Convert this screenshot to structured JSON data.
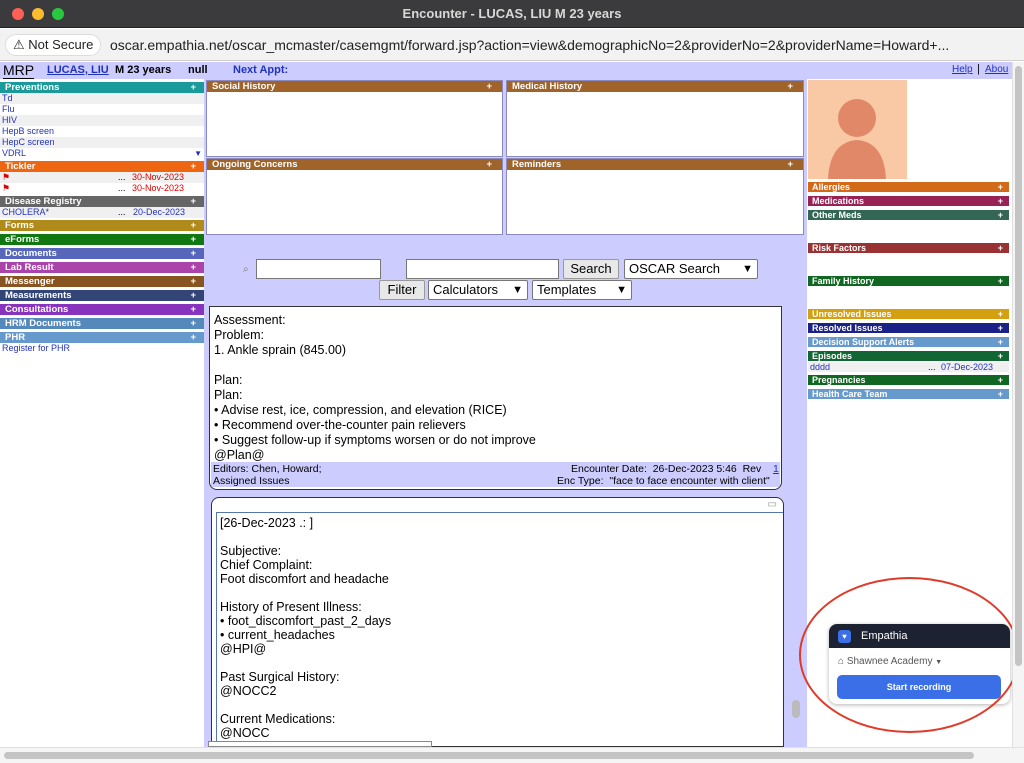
{
  "window": {
    "title": "Encounter - LUCAS, LIU M 23 years"
  },
  "address": {
    "security_label": "Not Secure",
    "url": "oscar.empathia.net/oscar_mcmaster/casemgmt/forward.jsp?action=view&demographicNo=2&providerNo=2&providerName=Howard+..."
  },
  "header": {
    "mrp": "MRP",
    "patient_name": "LUCAS, LIU",
    "patient_info": "M 23 years",
    "null_label": "null",
    "next_appt": "Next Appt:",
    "help": "Help",
    "about": "Abou"
  },
  "left": {
    "preventions": {
      "label": "Preventions",
      "items": [
        "Td",
        "Flu",
        "HIV",
        "HepB screen",
        "HepC screen",
        "VDRL"
      ]
    },
    "tickler": {
      "label": "Tickler",
      "items": [
        {
          "dots": "...",
          "date": "30-Nov-2023"
        },
        {
          "dots": "...",
          "date": "30-Nov-2023"
        }
      ]
    },
    "disease_registry": {
      "label": "Disease Registry",
      "items": [
        {
          "name": "CHOLERA*",
          "dots": "...",
          "date": "20-Dec-2023"
        }
      ]
    },
    "forms": "Forms",
    "eforms": "eForms",
    "documents": "Documents",
    "lab_result": "Lab Result",
    "messenger": "Messenger",
    "measurements": "Measurements",
    "consultations": "Consultations",
    "hrm_documents": "HRM Documents",
    "phr": {
      "label": "PHR",
      "items": [
        "Register for PHR"
      ]
    },
    "plus": "+"
  },
  "center": {
    "social_history": "Social History",
    "medical_history": "Medical History",
    "ongoing_concerns": "Ongoing Concerns",
    "reminders": "Reminders",
    "search_button": "Search",
    "search_select": "OSCAR Search",
    "filter_button": "Filter",
    "calculators": "Calculators",
    "templates": "Templates"
  },
  "note1": {
    "text": "Assessment:\nProblem:\n1. Ankle sprain (845.00)\n\nPlan:\nPlan:\n• Advise rest, ice, compression, and elevation (RICE)\n• Recommend over-the-counter pain relievers\n• Suggest follow-up if symptoms worsen or do not improve\n@Plan@",
    "editors": "Editors: Chen, Howard;",
    "encounter_date": "Encounter Date:  26-Dec-2023 5:46  Rev",
    "rev": "1",
    "assigned_issues": "Assigned Issues",
    "enc_type": "Enc Type:  \"face to face encounter with client\""
  },
  "note2": {
    "text": "[26-Dec-2023 .: ]\n\nSubjective:\nChief Complaint:\nFoot discomfort and headache\n\nHistory of Present Illness:\n• foot_discomfort_past_2_days\n• current_headaches\n@HPI@\n\nPast Surgical History:\n@NOCC2\n\nCurrent Medications:\n@NOCC"
  },
  "right": {
    "allergies": "Allergies",
    "medications": "Medications",
    "other_meds": "Other Meds",
    "risk_factors": "Risk Factors",
    "family_history": "Family History",
    "unresolved": "Unresolved Issues",
    "resolved": "Resolved Issues",
    "dsa": "Decision Support Alerts",
    "episodes": {
      "label": "Episodes",
      "item": "dddd",
      "dots": "...",
      "date": "07-Dec-2023"
    },
    "pregnancies": "Pregnancies",
    "health_care_team": "Health Care Team"
  },
  "empathia": {
    "title": "Empathia",
    "org": "Shawnee Academy",
    "button": "Start recording"
  },
  "colors": {
    "preventions": "#1a9a9a",
    "tickler": "#ee6611",
    "disease_registry": "#666666",
    "forms": "#b08a1a",
    "eforms": "#117711",
    "documents": "#5566bb",
    "lab_result": "#aa44aa",
    "messenger": "#885522",
    "measurements": "#334477",
    "consultations": "#8833bb",
    "hrm_documents": "#5588bb",
    "phr": "#6699cc"
  }
}
